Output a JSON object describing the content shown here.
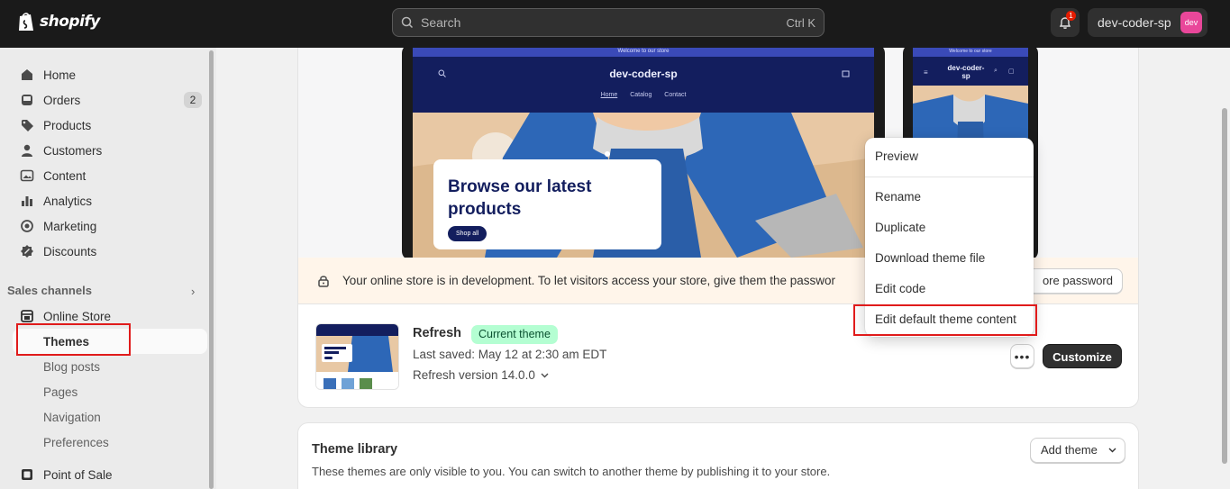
{
  "topbar": {
    "logo_text": "shopify",
    "search_placeholder": "Search",
    "search_shortcut": "Ctrl K",
    "notification_count": "1",
    "store_name": "dev-coder-sp",
    "avatar_text": "dev"
  },
  "sidebar": {
    "items": [
      {
        "label": "Home",
        "icon": "home-icon"
      },
      {
        "label": "Orders",
        "icon": "inbox-icon",
        "badge": "2"
      },
      {
        "label": "Products",
        "icon": "tag-icon"
      },
      {
        "label": "Customers",
        "icon": "person-icon"
      },
      {
        "label": "Content",
        "icon": "image-icon"
      },
      {
        "label": "Analytics",
        "icon": "bar-chart-icon"
      },
      {
        "label": "Marketing",
        "icon": "target-icon"
      },
      {
        "label": "Discounts",
        "icon": "discount-icon"
      }
    ],
    "sales_channels_label": "Sales channels",
    "online_store_label": "Online Store",
    "sub_items": [
      "Themes",
      "Blog posts",
      "Pages",
      "Navigation",
      "Preferences"
    ],
    "point_of_sale_label": "Point of Sale"
  },
  "preview": {
    "announcement": "Welcome to our store",
    "site_title": "dev-coder-sp",
    "nav_links": [
      "Home",
      "Catalog",
      "Contact"
    ],
    "hero_title_line1": "Browse our latest",
    "hero_title_line2": "products",
    "hero_button": "Shop all",
    "mobile_title": "dev-coder-sp"
  },
  "banner": {
    "text": "Your online store is in development. To let visitors access your store, give them the passwor",
    "button_label": "ore password"
  },
  "current_theme": {
    "name": "Refresh",
    "badge": "Current theme",
    "last_saved": "Last saved: May 12 at 2:30 am EDT",
    "version": "Refresh version 14.0.0",
    "more_label": "•••",
    "customize_label": "Customize"
  },
  "theme_menu": {
    "items": [
      "Preview",
      "Rename",
      "Duplicate",
      "Download theme file",
      "Edit code",
      "Edit default theme content"
    ]
  },
  "theme_library": {
    "title": "Theme library",
    "description": "These themes are only visible to you. You can switch to another theme by publishing it to your store.",
    "add_theme_label": "Add theme"
  },
  "colors": {
    "topbar_bg": "#1a1a1a",
    "highlight_red": "#e01b1b",
    "store_navy": "#131e5e",
    "badge_green": "#b4fed2"
  }
}
